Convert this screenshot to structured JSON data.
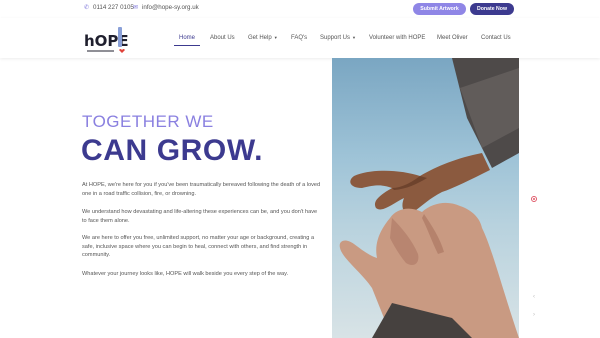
{
  "topbar": {
    "phone": "0114 227 0105",
    "email": "info@hope-sy.org.uk",
    "submit_label": "Submit Artwork",
    "donate_label": "Donate Now"
  },
  "logo": {
    "text": "hOPE"
  },
  "nav": {
    "items": [
      {
        "label": "Home"
      },
      {
        "label": "About Us"
      },
      {
        "label": "Get Help"
      },
      {
        "label": "FAQ's"
      },
      {
        "label": "Support Us"
      },
      {
        "label": "Volunteer with HOPE"
      },
      {
        "label": "Meet Oliver"
      },
      {
        "label": "Contact Us"
      }
    ]
  },
  "hero": {
    "pre_title": "TOGETHER WE",
    "title": "CAN GROW.",
    "paragraphs": [
      "At HOPE, we're here for you if you've been traumatically bereaved following the death of a loved one in a road traffic collision, fire, or drowning.",
      "We understand how devastating and life-altering these experiences can be, and you don't have to face them alone.",
      "We are here to offer you free, unlimited support, no matter your age or background, creating a safe, inclusive space where you can begin to heal, connect with others, and find strength in community.",
      "Whatever your journey looks like, HOPE will walk beside you every step of the way."
    ]
  },
  "colors": {
    "primary": "#3c3a8f",
    "accent": "#8a80e0",
    "button_light": "#8f86e6"
  },
  "icons": {
    "phone": "phone-icon",
    "email": "mail-icon",
    "dropdown": "chevron-down-icon"
  }
}
